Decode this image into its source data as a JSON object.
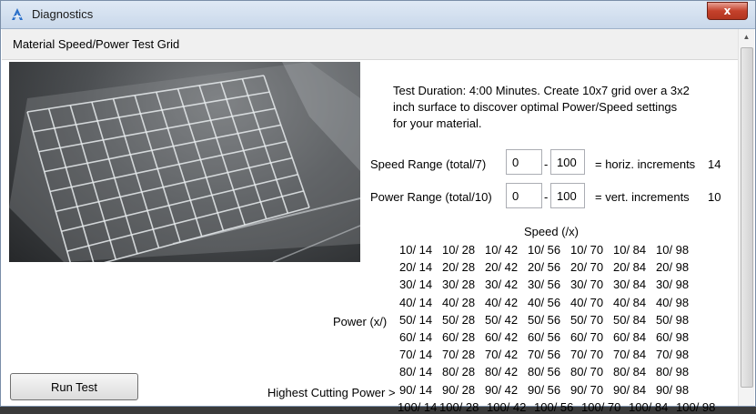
{
  "window": {
    "title": "Diagnostics",
    "close_glyph": "x"
  },
  "section": {
    "title": "Material Speed/Power Test Grid"
  },
  "photo": {
    "icon": "engraved-grid-photo"
  },
  "description": "Test Duration: 4:00 Minutes.  Create 10x7 grid over a 3x2\ninch surface to discover optimal Power/Speed settings\nfor your material.",
  "speed_range": {
    "label": "Speed Range (total/7)",
    "min": "0",
    "max": "100",
    "dash": "-",
    "increments_label": "= horiz. increments",
    "increments_value": "14"
  },
  "power_range": {
    "label": "Power Range (total/10)",
    "min": "0",
    "max": "100",
    "dash": "-",
    "increments_label": "= vert. increments",
    "increments_value": "10"
  },
  "grid": {
    "speed_header": "Speed (/x)",
    "power_label": "Power (x/)",
    "highest_label": "Highest Cutting Power >",
    "rows": [
      [
        "10/ 14",
        "10/ 28",
        "10/ 42",
        "10/ 56",
        "10/ 70",
        "10/ 84",
        "10/ 98"
      ],
      [
        "20/ 14",
        "20/ 28",
        "20/ 42",
        "20/ 56",
        "20/ 70",
        "20/ 84",
        "20/ 98"
      ],
      [
        "30/ 14",
        "30/ 28",
        "30/ 42",
        "30/ 56",
        "30/ 70",
        "30/ 84",
        "30/ 98"
      ],
      [
        "40/ 14",
        "40/ 28",
        "40/ 42",
        "40/ 56",
        "40/ 70",
        "40/ 84",
        "40/ 98"
      ],
      [
        "50/ 14",
        "50/ 28",
        "50/ 42",
        "50/ 56",
        "50/ 70",
        "50/ 84",
        "50/ 98"
      ],
      [
        "60/ 14",
        "60/ 28",
        "60/ 42",
        "60/ 56",
        "60/ 70",
        "60/ 84",
        "60/ 98"
      ],
      [
        "70/ 14",
        "70/ 28",
        "70/ 42",
        "70/ 56",
        "70/ 70",
        "70/ 84",
        "70/ 98"
      ],
      [
        "80/ 14",
        "80/ 28",
        "80/ 42",
        "80/ 56",
        "80/ 70",
        "80/ 84",
        "80/ 98"
      ],
      [
        "90/ 14",
        "90/ 28",
        "90/ 42",
        "90/ 56",
        "90/ 70",
        "90/ 84",
        "90/ 98"
      ],
      [
        "100/ 14",
        "100/ 28",
        "100/ 42",
        "100/ 56",
        "100/ 70",
        "100/ 84",
        "100/ 98"
      ]
    ]
  },
  "buttons": {
    "run_test": "Run Test"
  }
}
